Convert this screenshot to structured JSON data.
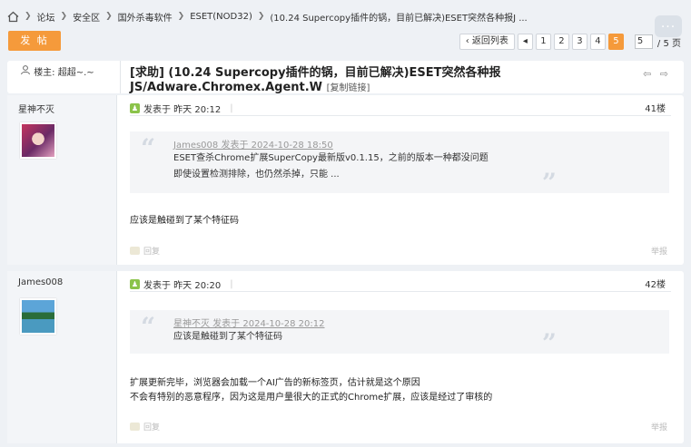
{
  "breadcrumb": {
    "items": [
      "论坛",
      "安全区",
      "国外杀毒软件",
      "ESET(NOD32)",
      "(10.24 Supercopy插件的锅，目前已解决)ESET突然各种报J ..."
    ]
  },
  "toolbar": {
    "post_label": "发 帖",
    "more_label": "..."
  },
  "pager": {
    "back_label": "返回列表",
    "prev_arrow": "◂",
    "pages": [
      "1",
      "2",
      "3",
      "4",
      "5"
    ],
    "current": "5",
    "input_value": "5",
    "total_text": "/ 5 页"
  },
  "thread": {
    "op_author": "楼主: 超超~.~",
    "title": "[求助] (10.24 Supercopy插件的锅，目前已解决)ESET突然各种报JS/Adware.Chromex.Agent.W",
    "copy_link": "[复制链接]",
    "nav_arrows": "⇦ ⇨"
  },
  "posts": [
    {
      "username": "星神不灭",
      "posted": "发表于 昨天 20:12",
      "floor": "41楼",
      "quote_author": "James008 发表于 2024-10-28 18:50",
      "quote_lines": [
        "ESET查杀Chrome扩展SuperCopy最新版v0.1.15，之前的版本一种都没问题",
        "即使设置检测排除，也仍然杀掉，只能 ..."
      ],
      "body_lines": [
        "应该是触碰到了某个特征码"
      ],
      "reply_label": "回复",
      "report_label": "举报"
    },
    {
      "username": "James008",
      "posted": "发表于 昨天 20:20",
      "floor": "42楼",
      "quote_author": "星神不灭 发表于 2024-10-28 20:12",
      "quote_lines": [
        "应该是触碰到了某个特征码"
      ],
      "body_lines": [
        "扩展更新完毕，浏览器会加载一个AI广告的新标签页，估计就是这个原因",
        "不会有特别的恶意程序，因为这是用户量很大的正式的Chrome扩展，应该是经过了审核的"
      ],
      "reply_label": "回复",
      "report_label": "举报"
    }
  ],
  "colors": {
    "accent": "#f59a3b",
    "background": "#eef1f5",
    "online": "#8bc34a"
  },
  "icons": [
    "home-icon",
    "online-status-icon",
    "quote-open-icon",
    "quote-close-icon",
    "reply-icon",
    "prev-thread-icon",
    "next-thread-icon",
    "more-icon",
    "user-icon"
  ]
}
